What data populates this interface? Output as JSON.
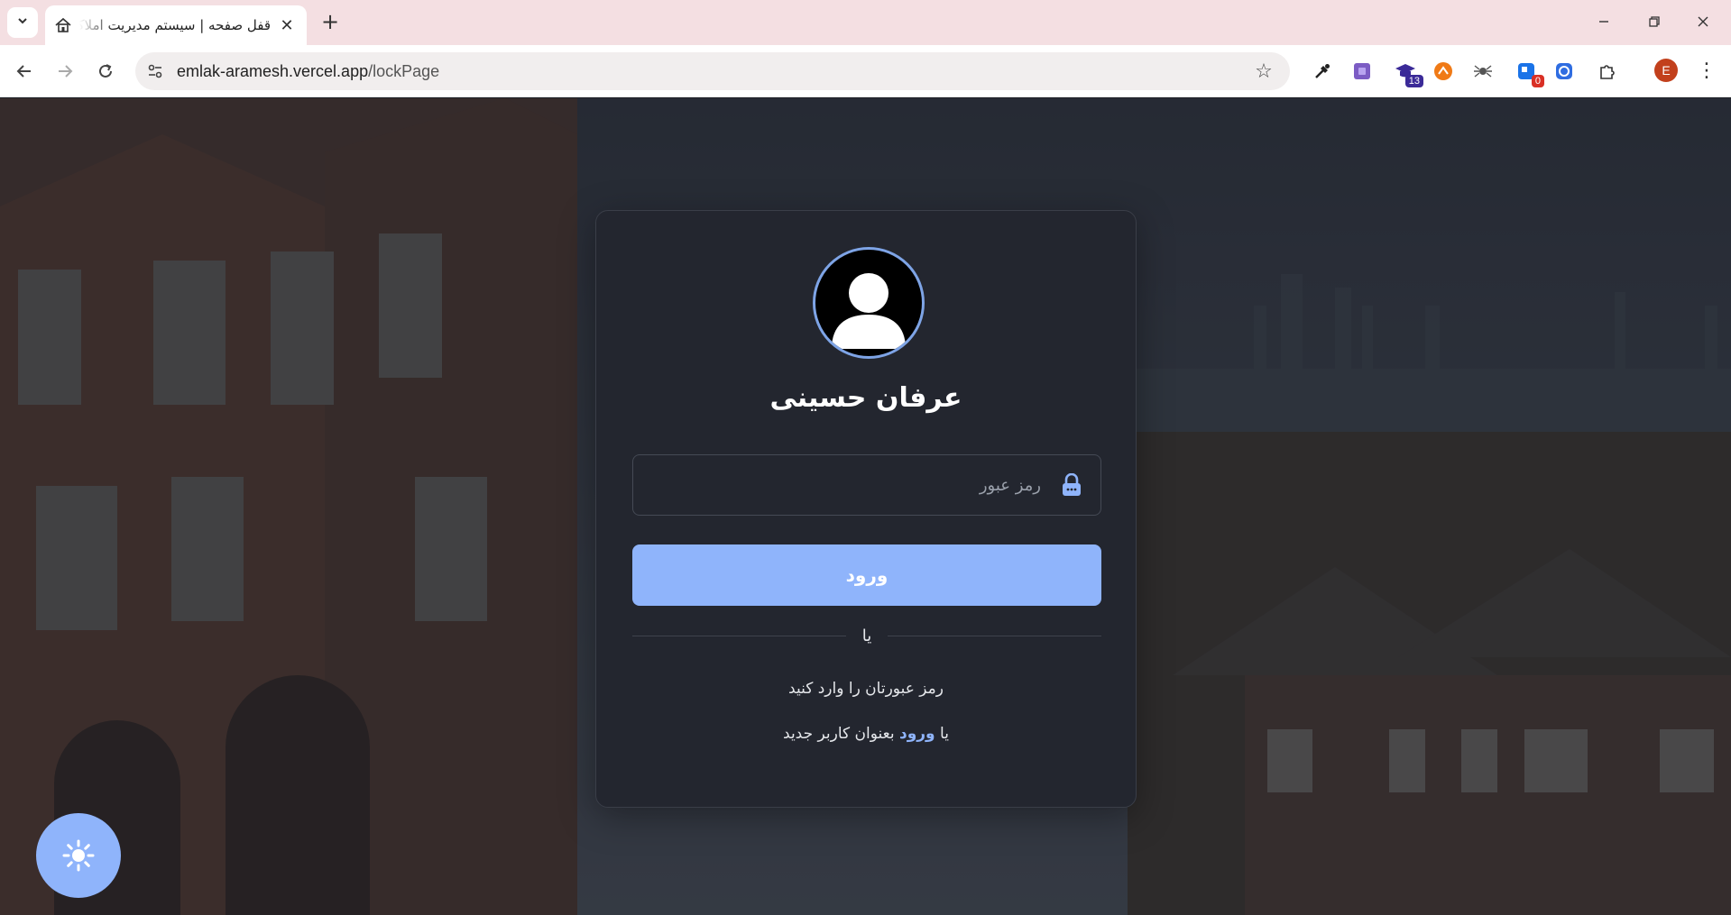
{
  "browser": {
    "tab": {
      "title": "قفل صفحه | سیستم مدیریت املاک",
      "close_icon": "close-icon"
    },
    "omnibox": {
      "url_host": "emlak-aramesh.vercel.app",
      "url_path": "/lockPage"
    },
    "extensions": [
      {
        "name": "eyedropper-icon",
        "badge": ""
      },
      {
        "name": "purple-extension-icon",
        "badge": ""
      },
      {
        "name": "graduation-cap-icon",
        "badge": "13",
        "badge_color": "#3b2a98"
      },
      {
        "name": "orange-extension-icon",
        "badge": ""
      },
      {
        "name": "spider-icon",
        "badge": ""
      },
      {
        "name": "blue-badge-extension-icon",
        "badge": "0",
        "badge_color": "#d93025"
      },
      {
        "name": "blue-circle-extension-icon",
        "badge": ""
      },
      {
        "name": "puzzle-icon",
        "badge": ""
      }
    ],
    "profile_initial": "E"
  },
  "lock": {
    "user_name": "عرفان حسینی",
    "password_placeholder": "رمز عبور",
    "login_button": "ورود",
    "divider_text": "یا",
    "hint": "رمز عبورتان را وارد کنید",
    "alt_prefix": "یا",
    "alt_link": "ورود",
    "alt_suffix": "بعنوان کاربر جدید"
  },
  "colors": {
    "accent": "#8fb4fb",
    "card": "#23262f",
    "avatar_ring": "#7ea4e6"
  }
}
